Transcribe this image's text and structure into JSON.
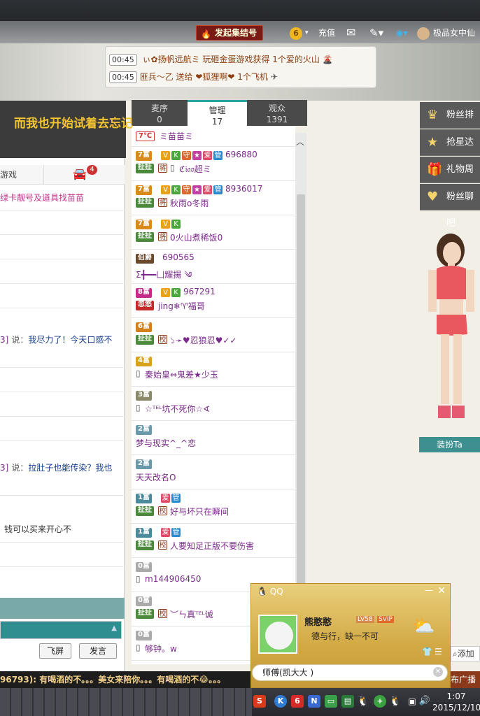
{
  "topbar": {
    "rally_label": "发起集结号",
    "level_badge": "6",
    "recharge": "充值",
    "username": "极品女中仙"
  },
  "announcements": [
    {
      "time": "00:45",
      "text": " ぃ✿扬帆远航ミ 玩砸金蛋游戏获得 1个爱的火山"
    },
    {
      "time": "00:45",
      "text": "匪兵～乙 送给 ❤狐狸啊❤ 1个飞机"
    }
  ],
  "room_title": "而我也开始试着去忘记",
  "left_panel": {
    "tab_game": "游戏",
    "car_badge": "4",
    "notice": "绿卡靓号及道具找苗苗",
    "msg1_prefix": "3]",
    "msg1_said": "说：",
    "msg1_text": "我尽力了！今天口感不",
    "msg2_prefix": "3]",
    "msg2_said": "说：",
    "msg2_text": "拉肚子也能传染？我也",
    "msg3_text": "钱可以买来开心不",
    "fullscreen_btn": "飞屏",
    "send_btn": "发言"
  },
  "tabs": [
    {
      "label": "麦序",
      "count": "0"
    },
    {
      "label": "管理",
      "count": "17"
    },
    {
      "label": "观众",
      "count": "1391"
    }
  ],
  "members": [
    {
      "level": "7富",
      "tags": [
        "V",
        "K",
        "守",
        "★",
        "爱",
        "管"
      ],
      "id": "696880",
      "badge": "扯扯",
      "shield": "将",
      "name": "ℭ𝔦𝔞𝔬超ミ",
      "has_phone": true
    },
    {
      "level": "7富",
      "tags": [
        "V",
        "K",
        "守",
        "★",
        "爱",
        "管"
      ],
      "id": "8936017",
      "badge": "扯扯",
      "shield": "将",
      "name": "秋雨o冬雨",
      "has_phone": false
    },
    {
      "level": "7富",
      "tags": [
        "V",
        "K"
      ],
      "id": "",
      "badge": "扯扯",
      "shield": "将",
      "name": "0火山煮稀饭0",
      "has_phone": false
    },
    {
      "level": "伯爵",
      "tags": [],
      "id": "690565",
      "badge": "",
      "shield": "",
      "name": "Σ╋━━凵耀揚 ༄",
      "has_phone": false
    },
    {
      "level": "8富",
      "tags": [
        "V",
        "K"
      ],
      "id": "967291",
      "badge": "忽悠",
      "shield": "",
      "name": "jing❄♈福哥",
      "has_phone": false
    },
    {
      "level": "6富",
      "tags": [],
      "id": "",
      "badge": "扯扯",
      "shield": "校",
      "name": "১➛♥忍狼忍♥✓✓",
      "has_phone": false
    },
    {
      "level": "4富",
      "tags": [],
      "id": "",
      "badge": "",
      "shield": "",
      "name": "秦始皇⇔鬼差★少玉",
      "has_phone": true
    },
    {
      "level": "3富",
      "tags": [],
      "id": "",
      "badge": "",
      "shield": "",
      "name": "☆ᵀᴱᴸ坑不死你☆∢",
      "has_phone": true
    },
    {
      "level": "2富",
      "tags": [],
      "id": "",
      "badge": "",
      "shield": "",
      "name": "梦与现实^_^恋",
      "has_phone": false
    },
    {
      "level": "2富",
      "tags": [],
      "id": "",
      "badge": "",
      "shield": "",
      "name": "天天改名O",
      "has_phone": false
    },
    {
      "level": "1富",
      "tags": [
        "爱",
        "管"
      ],
      "id": "",
      "badge": "扯扯",
      "shield": "校",
      "name": "好与坏只在瞬间",
      "has_phone": false
    },
    {
      "level": "1富",
      "tags": [
        "爱",
        "管"
      ],
      "id": "",
      "badge": "扯扯",
      "shield": "校",
      "name": "人要知足正版不要伤害",
      "has_phone": false
    },
    {
      "level": "0富",
      "tags": [],
      "id": "",
      "badge": "",
      "shield": "",
      "name": "m144906450",
      "has_phone": true
    },
    {
      "level": "0富",
      "tags": [],
      "id": "",
      "badge": "扯扯",
      "shield": "校",
      "name": "︶ㄣ真ᵀᴱᴸ诚",
      "has_phone": false
    },
    {
      "level": "0富",
      "tags": [],
      "id": "",
      "badge": "",
      "shield": "",
      "name": "够钟。w",
      "has_phone": true
    }
  ],
  "top_partial_name": "ミ苗苗ミ",
  "right_menu": [
    "粉丝排行",
    "抢星达人",
    "礼物周星",
    "粉丝聊吧"
  ],
  "dress_btn": "装扮Ta",
  "add_label": "添加",
  "qq_popup": {
    "title": "QQ",
    "nickname": "熊憨憨",
    "level": "LV58",
    "vip": "SVIP",
    "signature": "德与行，缺一不可",
    "message": "师傅(凯大大 )"
  },
  "marquee": "96793): 有喝酒的不。。。美女来陪你。。。有喝酒的不😂。。。",
  "marquee_right": "布广播",
  "taskbar": {
    "time": "1:07",
    "date": "2015/12/10"
  },
  "colors": {
    "accent": "#2aa3a3",
    "gold": "#f4c430",
    "purple_name": "#7a2a8a"
  }
}
